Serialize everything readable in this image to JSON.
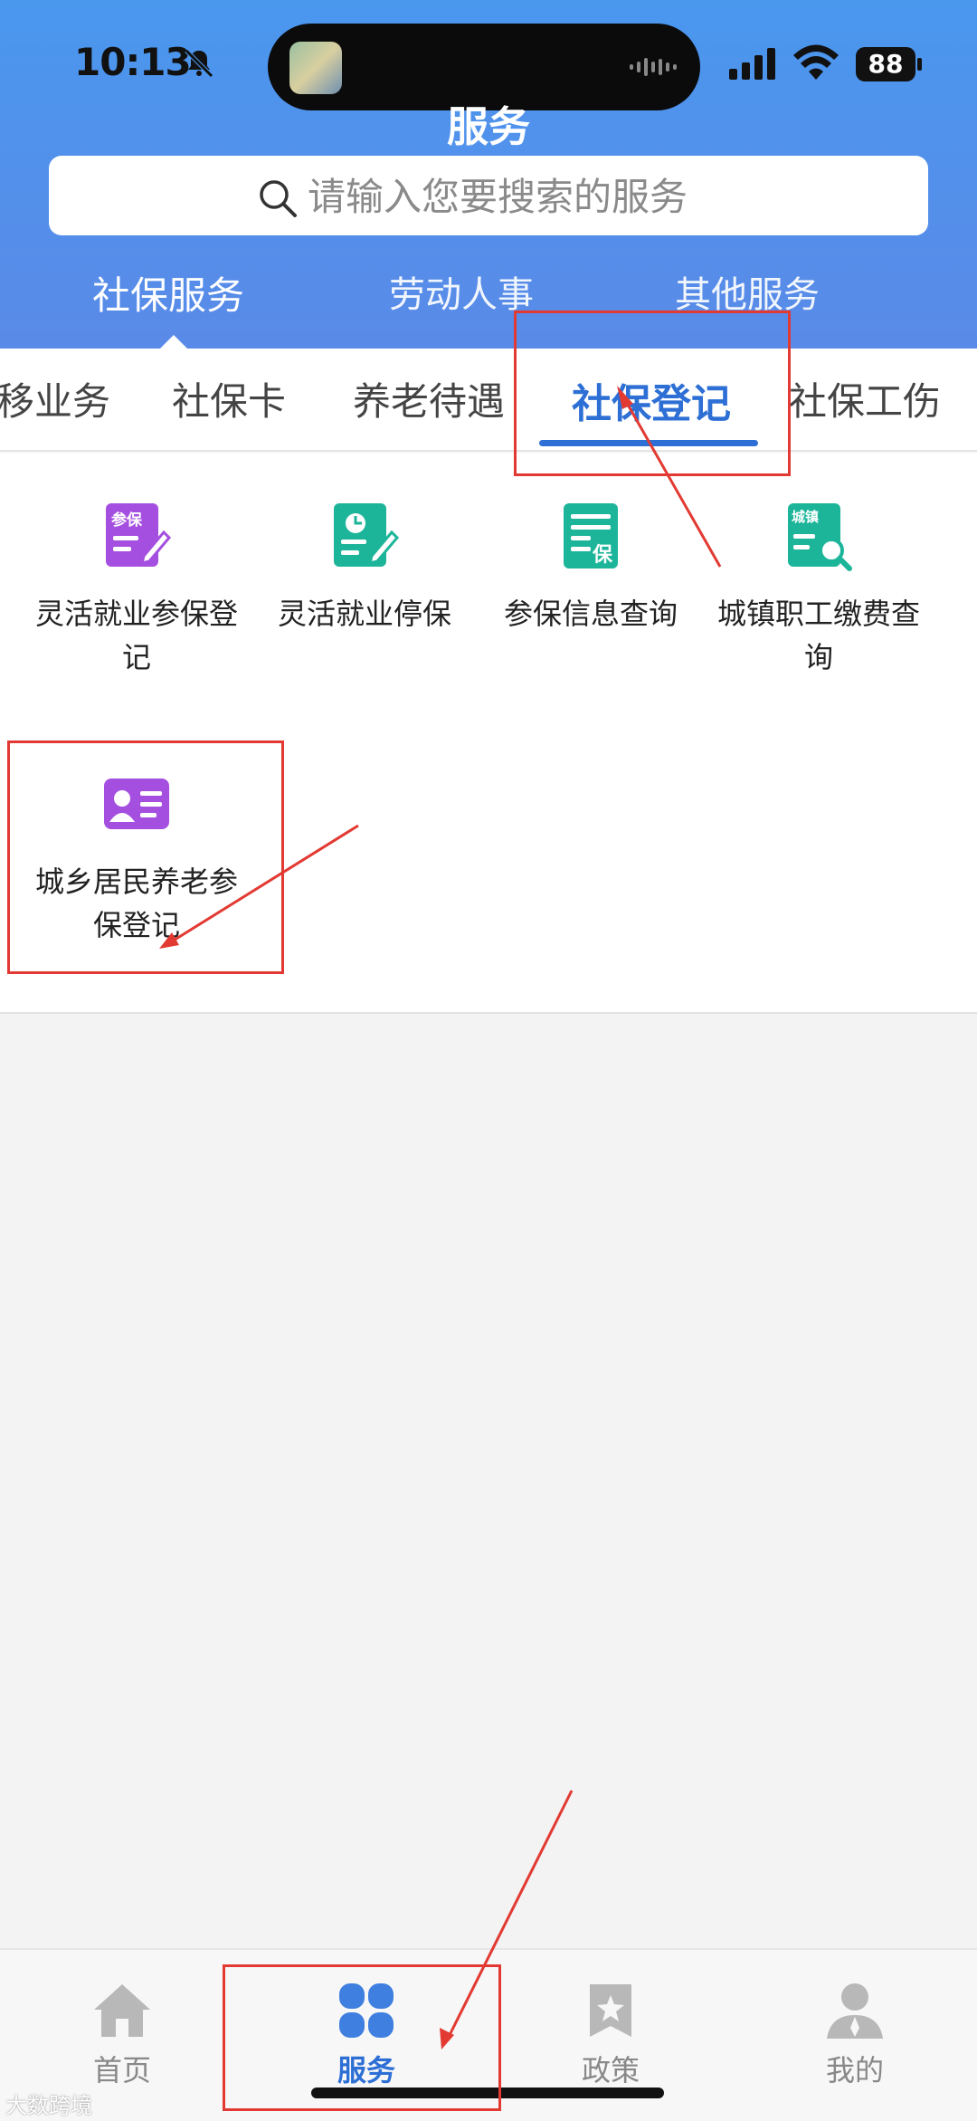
{
  "status_bar": {
    "time": "10:13",
    "battery": "88",
    "icons": [
      "bell-muted-icon",
      "signal-icon",
      "wifi-icon",
      "battery-icon",
      "dynamic-island"
    ]
  },
  "header": {
    "title": "服务",
    "search_placeholder": "请输入您要搜索的服务",
    "category_tabs": [
      {
        "label": "社保服务",
        "active": true
      },
      {
        "label": "劳动人事",
        "active": false
      },
      {
        "label": "其他服务",
        "active": false
      }
    ]
  },
  "sub_tabs": [
    {
      "label": "移业务",
      "active": false
    },
    {
      "label": "社保卡",
      "active": false
    },
    {
      "label": "养老待遇",
      "active": false
    },
    {
      "label": "社保登记",
      "active": true
    },
    {
      "label": "社保工伤",
      "active": false
    }
  ],
  "services": [
    {
      "label_1": "灵活就业参保登",
      "label_2": "记",
      "icon": "enroll-edit-icon",
      "icon_text": "参保",
      "color": "#a44fe0"
    },
    {
      "label_1": "灵活就业停保",
      "label_2": "",
      "icon": "pause-edit-icon",
      "icon_text": "",
      "color": "#1db59a"
    },
    {
      "label_1": "参保信息查询",
      "label_2": "",
      "icon": "insurance-doc-icon",
      "icon_text": "保",
      "color": "#1db59a"
    },
    {
      "label_1": "城镇职工缴费查",
      "label_2": "询",
      "icon": "urban-search-icon",
      "icon_text": "城镇",
      "color": "#1db59a"
    },
    {
      "label_1": "城乡居民养老参",
      "label_2": "保登记",
      "icon": "resident-card-icon",
      "icon_text": "",
      "color": "#a44fe0"
    }
  ],
  "bottom_nav": [
    {
      "label": "首页",
      "icon": "home-icon",
      "active": false
    },
    {
      "label": "服务",
      "icon": "services-clover-icon",
      "active": true
    },
    {
      "label": "政策",
      "icon": "policy-bookmark-icon",
      "active": false
    },
    {
      "label": "我的",
      "icon": "profile-icon",
      "active": false
    }
  ],
  "watermark": "大数跨境",
  "colors": {
    "header_gradient_top": "#4a97ee",
    "header_gradient_bottom": "#5a8ae8",
    "accent_blue": "#2d6fd5",
    "annotation_red": "#e23a32",
    "purple": "#a44fe0",
    "teal": "#1db59a"
  }
}
